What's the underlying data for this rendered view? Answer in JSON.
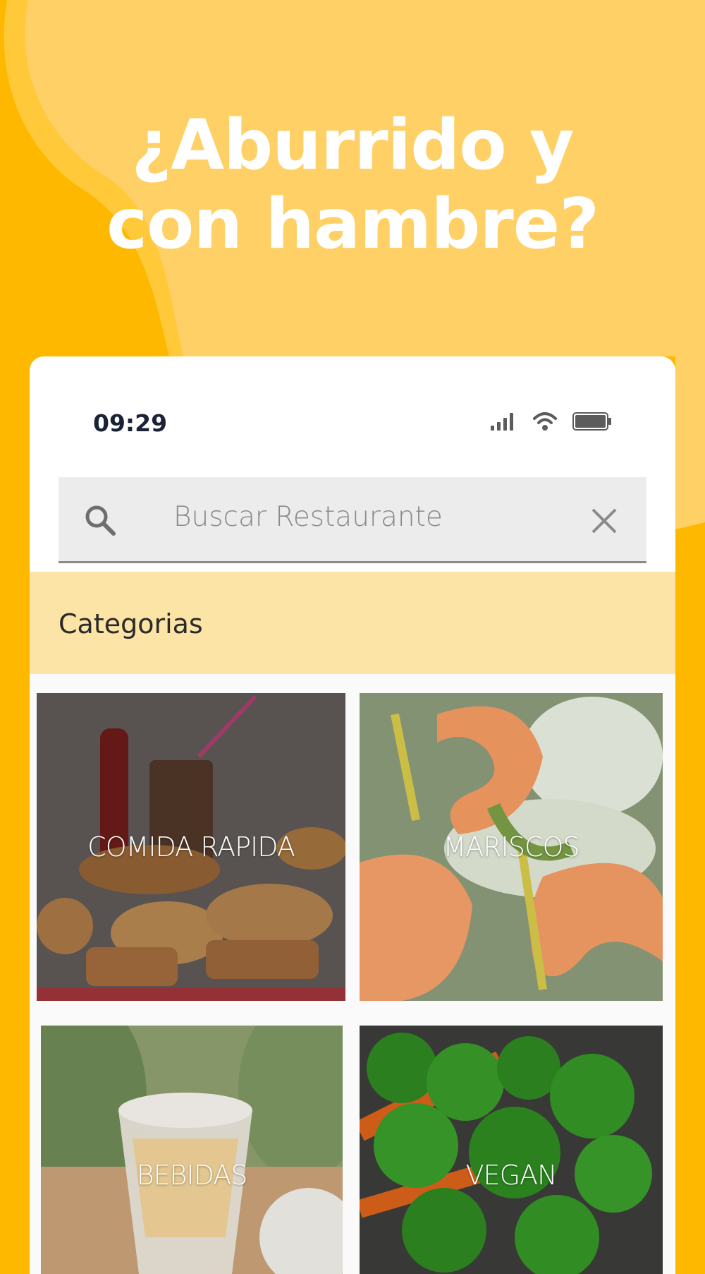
{
  "headline": {
    "line1": "¿Aburrido y",
    "line2": "con hambre?"
  },
  "status_bar": {
    "time": "09:29",
    "icons": [
      "signal-icon",
      "wifi-icon",
      "battery-icon"
    ]
  },
  "search": {
    "placeholder": "Buscar Restaurante",
    "icon": "search-icon",
    "clear_icon": "close-icon"
  },
  "categories": {
    "title": "Categorias",
    "items": [
      {
        "label": "COMIDA RAPIDA"
      },
      {
        "label": "MARISCOS"
      },
      {
        "label": "BEBIDAS"
      },
      {
        "label": "VEGAN"
      }
    ]
  },
  "colors": {
    "background": "#FFB800",
    "wave": "#FFD066",
    "category_header": "#FCE3A6"
  }
}
